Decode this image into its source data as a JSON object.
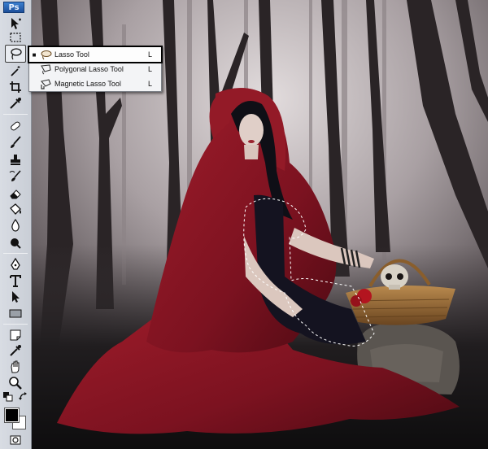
{
  "app": {
    "logo": "Ps"
  },
  "toolbar": {
    "tools": [
      {
        "name": "move-icon"
      },
      {
        "name": "marquee-icon"
      },
      {
        "name": "lasso-icon",
        "active": true
      },
      {
        "name": "magic-wand-icon"
      },
      {
        "name": "crop-icon"
      },
      {
        "name": "eyedropper-icon"
      },
      {
        "name": "healing-brush-icon"
      },
      {
        "name": "brush-icon"
      },
      {
        "name": "clone-stamp-icon"
      },
      {
        "name": "history-brush-icon"
      },
      {
        "name": "eraser-icon"
      },
      {
        "name": "paint-bucket-icon"
      },
      {
        "name": "blur-icon"
      },
      {
        "name": "dodge-icon"
      },
      {
        "name": "pen-icon"
      },
      {
        "name": "type-icon"
      },
      {
        "name": "path-selection-icon"
      },
      {
        "name": "rectangle-shape-icon"
      },
      {
        "name": "notes-icon"
      },
      {
        "name": "eyedropper-sample-icon"
      },
      {
        "name": "hand-icon"
      },
      {
        "name": "zoom-icon"
      }
    ],
    "foreground_color": "#000000",
    "background_color": "#ffffff"
  },
  "flyout": {
    "items": [
      {
        "label": "Lasso Tool",
        "shortcut": "L",
        "selected": true,
        "icon": "lasso-icon"
      },
      {
        "label": "Polygonal Lasso Tool",
        "shortcut": "L",
        "selected": false,
        "icon": "polygonal-lasso-icon"
      },
      {
        "label": "Magnetic Lasso Tool",
        "shortcut": "L",
        "selected": false,
        "icon": "magnetic-lasso-icon"
      }
    ]
  },
  "colors": {
    "cloak": "#8a1520",
    "fog": "#bdb5b7",
    "ground": "#1c1a1c"
  }
}
